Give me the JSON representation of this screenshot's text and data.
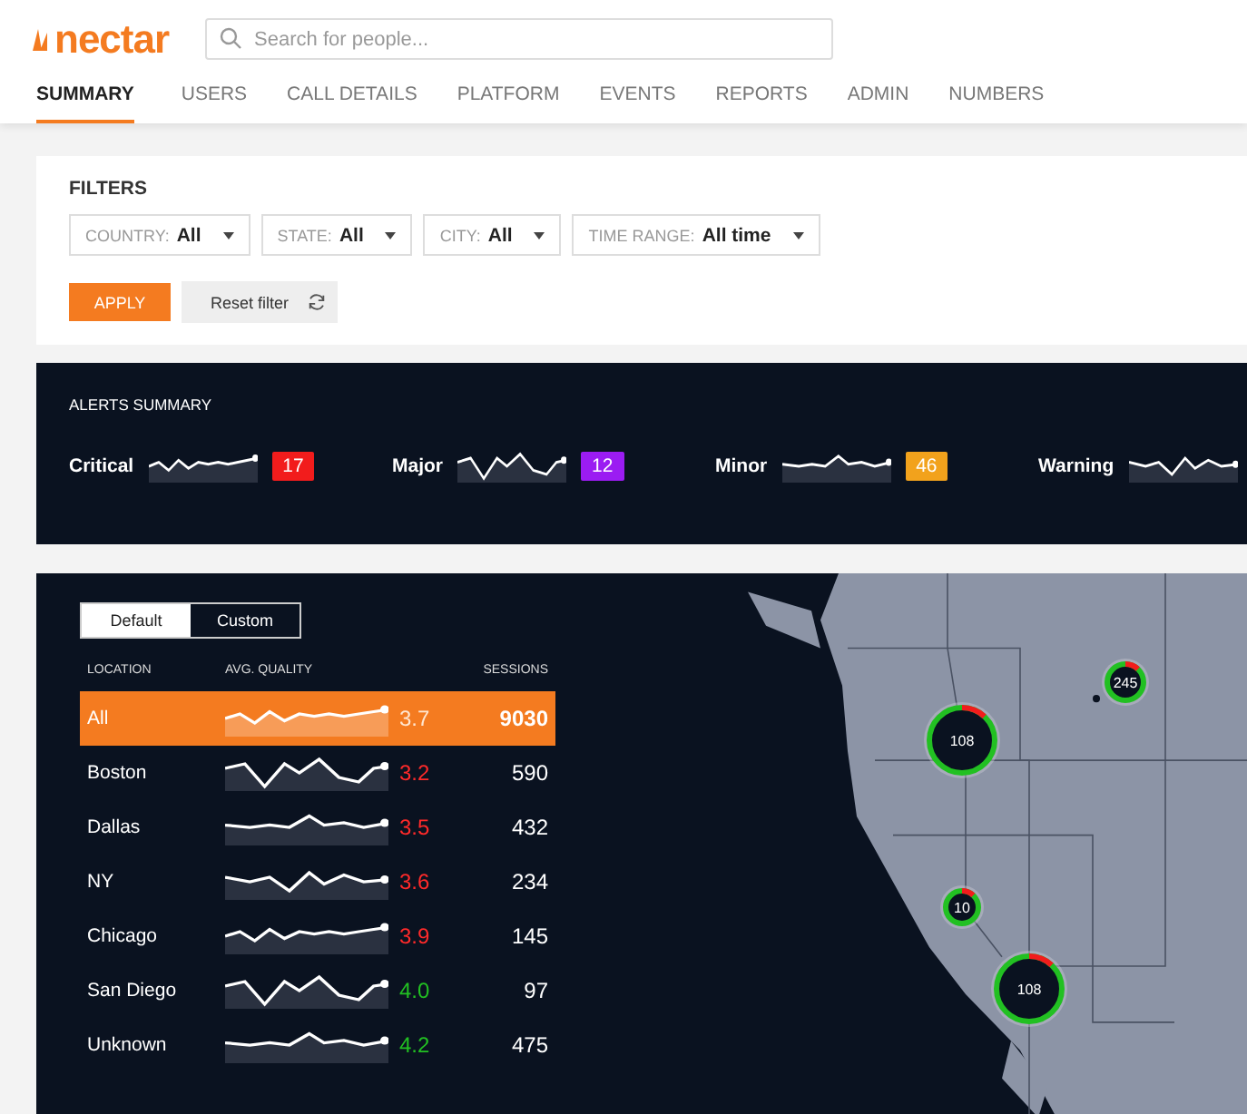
{
  "header": {
    "logo": "nectar",
    "search": {
      "placeholder": "Search for people..."
    }
  },
  "tabs": [
    {
      "label": "SUMMARY",
      "selected": true
    },
    {
      "label": "USERS",
      "selected": false
    },
    {
      "label": "CALL DETAILS",
      "selected": false
    },
    {
      "label": "PLATFORM",
      "selected": false
    },
    {
      "label": "EVENTS",
      "selected": false
    },
    {
      "label": "REPORTS",
      "selected": false
    },
    {
      "label": "ADMIN",
      "selected": false
    },
    {
      "label": "NUMBERS",
      "selected": false
    }
  ],
  "filters": {
    "title": "FILTERS",
    "dropdowns": [
      {
        "label": "COUNTRY:",
        "value": "All"
      },
      {
        "label": "STATE:",
        "value": "All"
      },
      {
        "label": "CITY:",
        "value": "All"
      },
      {
        "label": "TIME RANGE:",
        "value": "All time"
      }
    ],
    "apply": "APPLY",
    "reset": "Reset filter"
  },
  "alerts": {
    "title": "ALERTS SUMMARY",
    "items": [
      {
        "label": "Critical",
        "count": "17",
        "color": "#f21c1c"
      },
      {
        "label": "Major",
        "count": "12",
        "color": "#9b1cf2"
      },
      {
        "label": "Minor",
        "count": "46",
        "color": "#f2a21c"
      },
      {
        "label": "Warning"
      }
    ]
  },
  "locations": {
    "toggle": [
      {
        "label": "Default",
        "selected": true
      },
      {
        "label": "Custom",
        "selected": false
      }
    ],
    "columns": [
      "LOCATION",
      "AVG. QUALITY",
      "SESSIONS"
    ],
    "rows": [
      {
        "location": "All",
        "quality": "3.7",
        "color": "#ffe6d0",
        "sessions": "9030",
        "selected": true
      },
      {
        "location": "Boston",
        "quality": "3.2",
        "color": "#ff2a2a",
        "sessions": "590",
        "selected": false
      },
      {
        "location": "Dallas",
        "quality": "3.5",
        "color": "#ff2a2a",
        "sessions": "432",
        "selected": false
      },
      {
        "location": "NY",
        "quality": "3.6",
        "color": "#ff2a2a",
        "sessions": "234",
        "selected": false
      },
      {
        "location": "Chicago",
        "quality": "3.9",
        "color": "#ff2a2a",
        "sessions": "145",
        "selected": false
      },
      {
        "location": "San Diego",
        "quality": "4.0",
        "color": "#22c022",
        "sessions": "97",
        "selected": false
      },
      {
        "location": "Unknown",
        "quality": "4.2",
        "color": "#22c022",
        "sessions": "475",
        "selected": false
      }
    ]
  },
  "map": {
    "kind": "picture",
    "markers": [
      {
        "label": "108"
      },
      {
        "label": "245"
      },
      {
        "label": "10"
      },
      {
        "label": "108"
      }
    ]
  }
}
